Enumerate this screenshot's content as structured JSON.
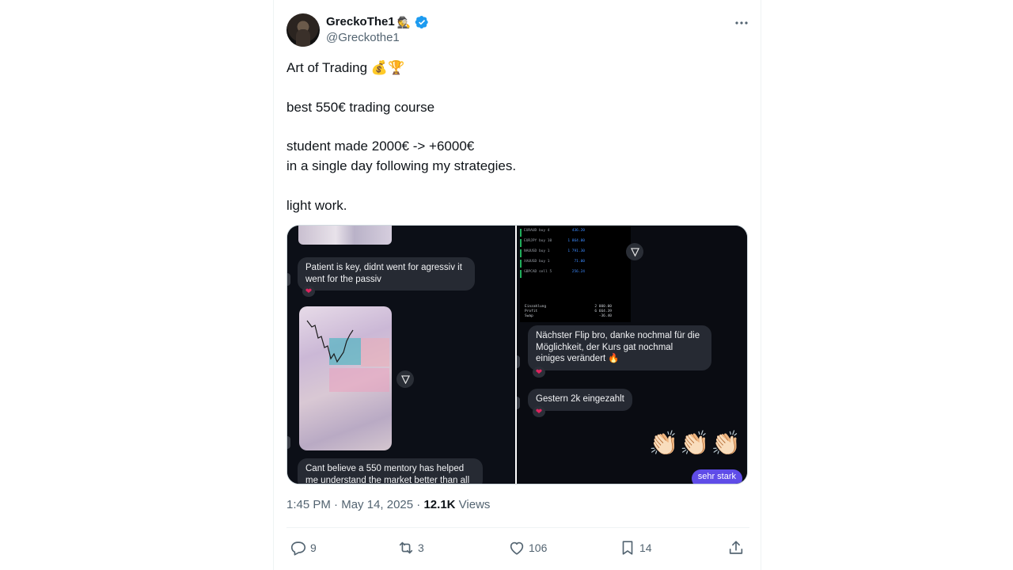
{
  "author": {
    "display_name": "GreckoThe1",
    "name_emoji": "🕵",
    "handle": "@Greckothe1",
    "verified_icon": "verified-badge-icon"
  },
  "tweet": {
    "lines": [
      "Art of Trading 💰🏆",
      "",
      "best 550€ trading course",
      "",
      "student made 2000€ -> +6000€",
      "in a single day following my strategies.",
      "",
      "light work."
    ],
    "time": "1:45 PM",
    "separator": "·",
    "date": "May 14, 2025",
    "views_count": "12.1K",
    "views_label": "Views"
  },
  "media": {
    "left": {
      "bubble1": "Patient is key, didnt went for agressiv it\nwent for the passiv",
      "bubble2": "Cant believe a 550 mentory has helped\nme understand the market better than all"
    },
    "right": {
      "bubble1": "Nächster Flip bro, danke nochmal für die\nMöglichkeit, der Kurs gat nochmal\neiniges verändert 🔥",
      "bubble2": "Gestern 2k eingezahlt",
      "claps": "👏🏻👏🏻👏🏻",
      "pill": "sehr stark",
      "trades": [
        {
          "pair": "EURAUD buy 4",
          "value": "436.20"
        },
        {
          "pair": "EURJPY buy 10",
          "value": "1 864.00"
        },
        {
          "pair": "NAUUSD buy 1",
          "value": "1 791.30"
        },
        {
          "pair": "XAUUSD buy 1",
          "value": "71.00"
        },
        {
          "pair": "GBPCAD sell 5",
          "value": "256.24"
        }
      ],
      "summary": [
        {
          "k": "Einzahlung",
          "v": "2 000.00"
        },
        {
          "k": "Profit",
          "v": "6 664.39"
        },
        {
          "k": "Swap",
          "v": "-36.40"
        }
      ]
    }
  },
  "actions": {
    "replies": "9",
    "reposts": "3",
    "likes": "106",
    "bookmarks": "14"
  },
  "colors": {
    "accent": "#1d9bf0",
    "muted": "#536471",
    "text": "#0f1419"
  }
}
